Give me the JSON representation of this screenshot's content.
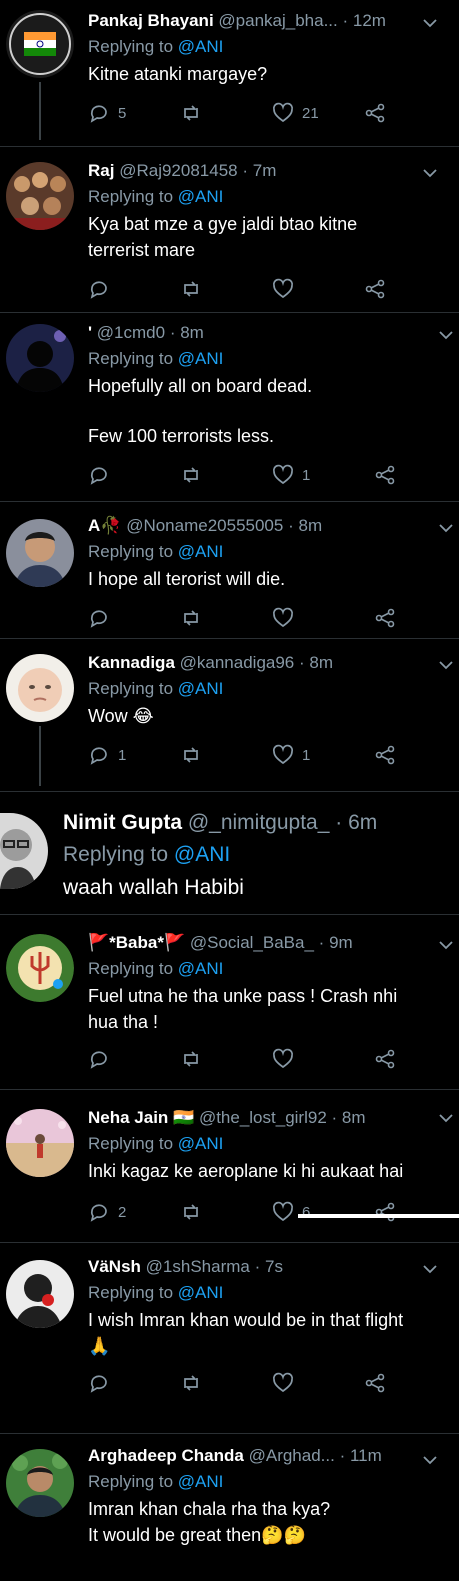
{
  "tweets": [
    {
      "name": "Pankaj Bhayani",
      "handle": "@pankaj_bha...",
      "time": "12m",
      "reply_prefix": "Replying to ",
      "reply_to": "@ANI",
      "lines": [
        "Kitne atanki margaye?"
      ],
      "replies": "5",
      "retweets": "",
      "likes": "21",
      "avatar_icon": "made-in-india-seal-icon"
    },
    {
      "name": "Raj",
      "handle": "@Raj92081458",
      "time": "7m",
      "reply_prefix": "Replying to ",
      "reply_to": "@ANI",
      "lines": [
        "Kya bat mze a gye jaldi btao kitne",
        "terrerist mare"
      ],
      "replies": "",
      "retweets": "",
      "likes": "",
      "avatar_icon": "group-photo-icon"
    },
    {
      "name": "'",
      "handle": "@1cmd0",
      "time": "8m",
      "reply_prefix": "Replying to ",
      "reply_to": "@ANI",
      "lines": [
        "Hopefully all on board dead.",
        "",
        "Few 100 terrorists less."
      ],
      "replies": "",
      "retweets": "",
      "likes": "1",
      "avatar_icon": "silhouette-night-icon"
    },
    {
      "name": "A🥀",
      "handle": "@Noname20555005",
      "time": "8m",
      "reply_prefix": "Replying to ",
      "reply_to": "@ANI",
      "lines": [
        "I hope all terorist will die."
      ],
      "replies": "",
      "retweets": "",
      "likes": "",
      "avatar_icon": "young-man-photo-icon"
    },
    {
      "name": "Kannadiga",
      "handle": "@kannadiga96",
      "time": "8m",
      "reply_prefix": "Replying to ",
      "reply_to": "@ANI",
      "lines": [
        "Wow 😂"
      ],
      "replies": "1",
      "retweets": "",
      "likes": "1",
      "avatar_icon": "baby-face-icon"
    },
    {
      "name": "Nimit Gupta",
      "handle": "@_nimitgupta_",
      "time": "6m",
      "reply_prefix": "Replying to ",
      "reply_to": "@ANI",
      "lines": [
        "waah wallah Habibi"
      ],
      "replies": "",
      "retweets": "",
      "likes": "",
      "avatar_icon": "man-with-glasses-icon"
    },
    {
      "name": "🚩*Baba*🚩",
      "handle": "@Social_BaBa_",
      "time": "9m",
      "reply_prefix": "Replying to ",
      "reply_to": "@ANI",
      "lines": [
        "Fuel utna he tha unke pass ! Crash nhi",
        "hua tha !"
      ],
      "replies": "",
      "retweets": "",
      "likes": "",
      "avatar_icon": "social-baba-trident-icon"
    },
    {
      "name": "Neha Jain 🇮🇳",
      "handle": "@the_lost_girl92",
      "time": "8m",
      "reply_prefix": "Replying to ",
      "reply_to": "@ANI",
      "lines": [
        "Inki kagaz ke aeroplane ki hi aukaat hai"
      ],
      "replies": "2",
      "retweets": "",
      "likes": "6",
      "avatar_icon": "beach-photo-icon"
    },
    {
      "name": "VäNsh",
      "handle": "@1shSharma",
      "time": "7s",
      "reply_prefix": "Replying to ",
      "reply_to": "@ANI",
      "lines": [
        "I wish Imran khan would be in that flight",
        "🙏"
      ],
      "replies": "",
      "retweets": "",
      "likes": "",
      "avatar_icon": "man-with-rose-icon"
    },
    {
      "name": "Arghadeep Chanda",
      "handle": "@Arghad...",
      "time": "11m",
      "reply_prefix": "Replying to ",
      "reply_to": "@ANI",
      "lines": [
        "Imran khan chala rha tha kya?",
        "It would be great then🤔🤔"
      ],
      "replies": "",
      "retweets": "",
      "likes": "",
      "avatar_icon": "boy-in-garden-icon"
    }
  ],
  "colors": {
    "background": "#000000",
    "name": "#ffffff",
    "muted": "#8899a6",
    "link": "#1da1f2",
    "divider": "#2a2f33"
  }
}
